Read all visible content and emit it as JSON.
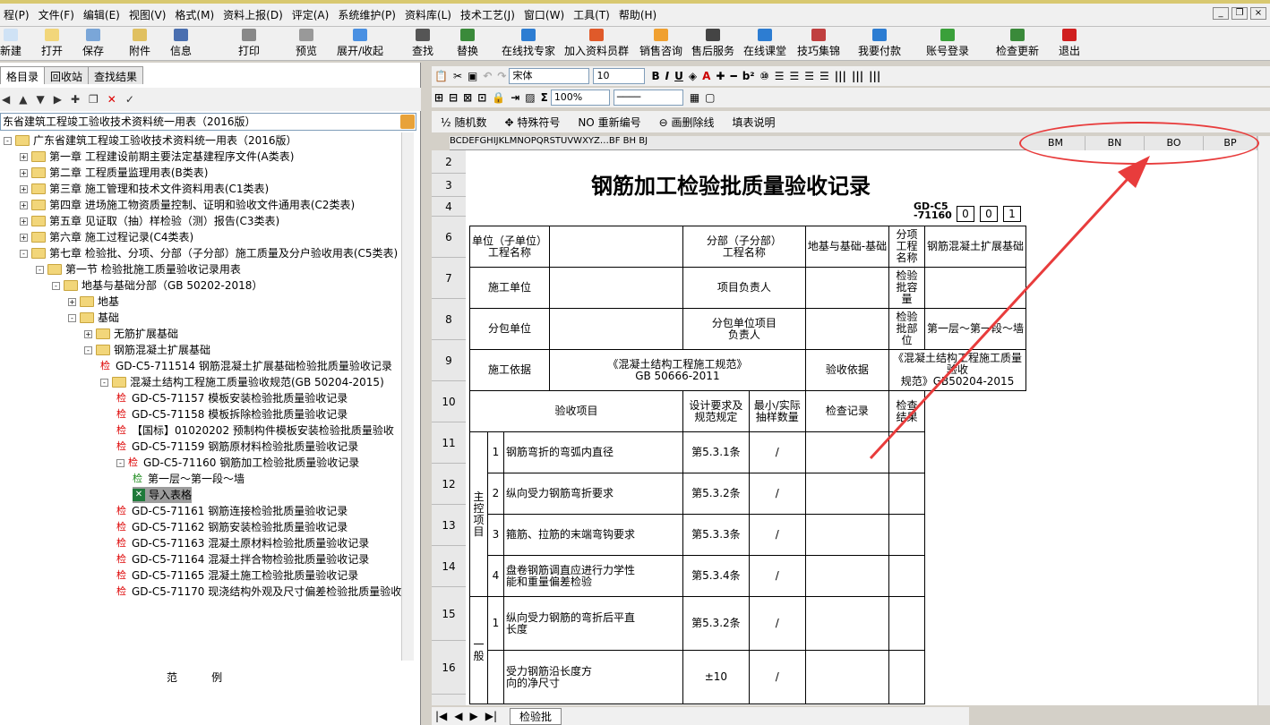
{
  "menu": [
    "程(P)",
    "文件(F)",
    "编辑(E)",
    "视图(V)",
    "格式(M)",
    "资料上报(D)",
    "评定(A)",
    "系统维护(P)",
    "资料库(L)",
    "技术工艺(J)",
    "窗口(W)",
    "工具(T)",
    "帮助(H)"
  ],
  "toolbar": [
    "新建",
    "打开",
    "保存",
    "附件",
    "信息",
    "打印",
    "预览",
    "展开/收起",
    "查找",
    "替换",
    "在线找专家",
    "加入资料员群",
    "销售咨询",
    "售后服务",
    "在线课堂",
    "技巧集锦",
    "我要付款",
    "账号登录",
    "检查更新",
    "退出"
  ],
  "left": {
    "tabs": [
      "格目录",
      "回收站",
      "查找结果"
    ],
    "combo": "东省建筑工程竣工验收技术资料统一用表（2016版）",
    "tree": [
      {
        "label": "广东省建筑工程竣工验收技术资料统一用表（2016版）"
      },
      {
        "label": "第一章 工程建设前期主要法定基建程序文件(A类表)"
      },
      {
        "label": "第二章 工程质量监理用表(B类表)"
      },
      {
        "label": "第三章 施工管理和技术文件资料用表(C1类表)"
      },
      {
        "label": "第四章 进场施工物资质量控制、证明和验收文件通用表(C2类表)"
      },
      {
        "label": "第五章  见证取（抽）样检验（测）报告(C3类表)"
      },
      {
        "label": "第六章 施工过程记录(C4类表)"
      },
      {
        "label": "第七章 检验批、分项、分部（子分部）施工质量及分户验收用表(C5类表)"
      },
      {
        "label": "第一节 检验批施工质量验收记录用表"
      },
      {
        "label": "地基与基础分部（GB 50202-2018）"
      },
      {
        "label": "地基"
      },
      {
        "label": "基础"
      },
      {
        "label": "无筋扩展基础"
      },
      {
        "label": "钢筋混凝土扩展基础"
      },
      {
        "label": "GD-C5-711514 钢筋混凝土扩展基础检验批质量验收记录"
      },
      {
        "label": "混凝土结构工程施工质量验收规范(GB 50204-2015)"
      },
      {
        "label": "GD-C5-71157 模板安装检验批质量验收记录"
      },
      {
        "label": "GD-C5-71158 模板拆除检验批质量验收记录"
      },
      {
        "label": "【国标】01020202 预制构件模板安装检验批质量验收"
      },
      {
        "label": "GD-C5-71159 钢筋原材料检验批质量验收记录"
      },
      {
        "label": "GD-C5-71160 钢筋加工检验批质量验收记录"
      },
      {
        "label": "第一层～第一段～墙"
      },
      {
        "label": "导入表格"
      },
      {
        "label": "GD-C5-71161 钢筋连接检验批质量验收记录"
      },
      {
        "label": "GD-C5-71162 钢筋安装检验批质量验收记录"
      },
      {
        "label": "GD-C5-71163 混凝土原材料检验批质量验收记录"
      },
      {
        "label": "GD-C5-71164 混凝土拌合物检验批质量验收记录"
      },
      {
        "label": "GD-C5-71165 混凝土施工检验批质量验收记录"
      },
      {
        "label": "GD-C5-71170 现浇结构外观及尺寸偏差检验批质量验收"
      }
    ],
    "check_mark": "检",
    "legend": "范          例"
  },
  "format": {
    "font": "宋体",
    "size": "10",
    "zoom": "100%",
    "row3": [
      "½ 随机数",
      "✥ 特殊符号",
      "NO 重新编号",
      "⊖ 画删除线",
      "填表说明"
    ]
  },
  "cols": "BCDEFGHIJKLMNOPQRSTUVWXYZ…BF BH BJ",
  "extra_cols": [
    "BM",
    "BN",
    "BO",
    "BP"
  ],
  "rows": [
    "2",
    "3",
    "4",
    "6",
    "7",
    "8",
    "9",
    "10",
    "11",
    "12",
    "13",
    "14",
    "15",
    "16"
  ],
  "form": {
    "title": "钢筋加工检验批质量验收记录",
    "code": "GD-C5\n-71160",
    "code_boxes": [
      "0",
      "0",
      "1"
    ],
    "r6": [
      "单位（子单位）\n工程名称",
      "分部（子分部）\n工程名称",
      "地基与基础-基础",
      "分项\n工程\n名称",
      "钢筋混凝土扩展基础"
    ],
    "r7": [
      "施工单位",
      "项目负责人",
      "检验\n批容\n量"
    ],
    "r8": [
      "分包单位",
      "分包单位项目\n负责人",
      "检验\n批部\n位",
      "第一层～第一段～墙"
    ],
    "r9": [
      "施工依据",
      "《混凝土结构工程施工规范》\nGB 50666-2011",
      "验收依据",
      "《混凝土结构工程施工质量\n验收\n规范》GB50204-2015"
    ],
    "r10": [
      "验收项目",
      "设计要求及\n规范规定",
      "最小/实际\n抽样数量",
      "检查记录",
      "检查\n结果"
    ],
    "main_label": "主\n控\n项\n目",
    "general_label": "一\n般",
    "items": [
      {
        "no": "1",
        "name": "钢筋弯折的弯弧内直径",
        "rule": "第5.3.1条"
      },
      {
        "no": "2",
        "name": "纵向受力钢筋弯折要求",
        "rule": "第5.3.2条"
      },
      {
        "no": "3",
        "name": "箍筋、拉筋的末端弯钩要求",
        "rule": "第5.3.3条"
      },
      {
        "no": "4",
        "name": "盘卷钢筋调直应进行力学性\n能和重量偏差检验",
        "rule": "第5.3.4条"
      },
      {
        "no": "1",
        "name": "纵向受力钢筋的弯折后平直\n长度",
        "rule": "第5.3.2条"
      },
      {
        "no": "",
        "name": "受力钢筋沿长度方\n向的净尺寸",
        "rule": "±10"
      }
    ],
    "slash": "/"
  },
  "sheet_tab": "检验批"
}
